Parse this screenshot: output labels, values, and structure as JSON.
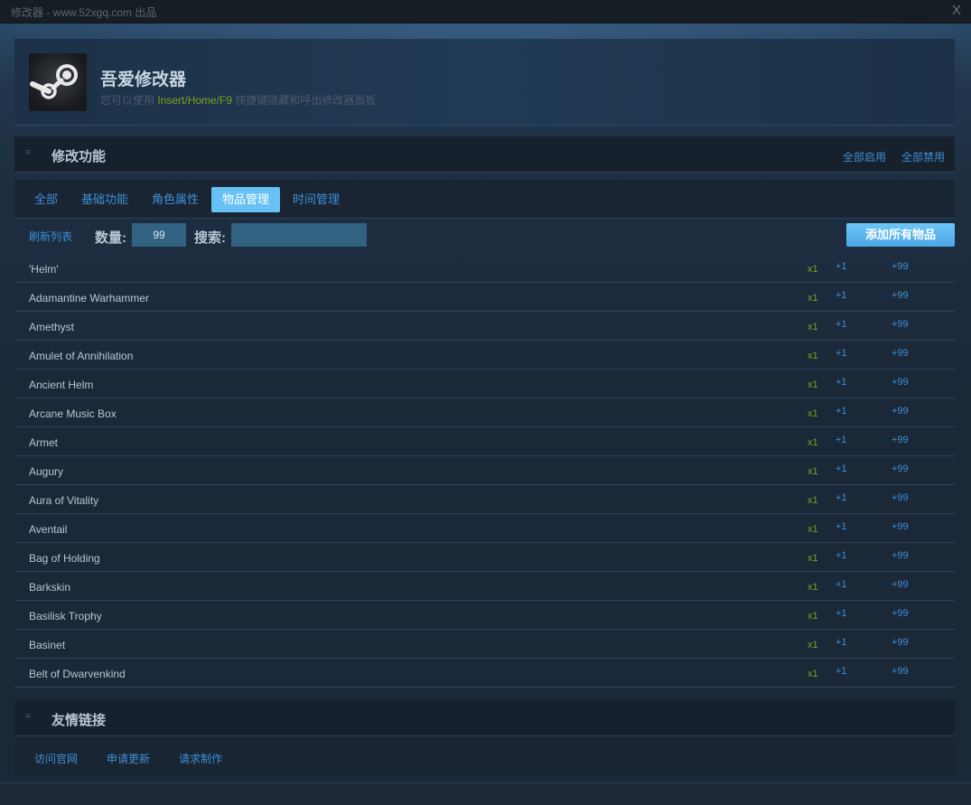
{
  "window": {
    "title": "修改器 - www.52xgq.com 出品",
    "close_label": "X"
  },
  "header": {
    "app_title": "吾爱修改器",
    "subtitle_prefix": "您可以使用",
    "hotkeys": "Insert/Home/F9",
    "subtitle_suffix": "快捷键隐藏和呼出修改器面板"
  },
  "features": {
    "grip": "=",
    "title": "修改功能",
    "enable_all": "全部启用",
    "disable_all": "全部禁用",
    "tabs": [
      {
        "label": "全部",
        "active": false
      },
      {
        "label": "基础功能",
        "active": false
      },
      {
        "label": "角色属性",
        "active": false
      },
      {
        "label": "物品管理",
        "active": true
      },
      {
        "label": "时间管理",
        "active": false
      }
    ]
  },
  "toolbar": {
    "refresh_label": "刷新列表",
    "quantity_label": "数量:",
    "quantity_value": "99",
    "search_label": "搜索:",
    "search_value": "",
    "add_all_label": "添加所有物品"
  },
  "items": [
    {
      "name": "'Helm'",
      "count": "x1",
      "plus1": "+1",
      "plus99": "+99"
    },
    {
      "name": "Adamantine Warhammer",
      "count": "x1",
      "plus1": "+1",
      "plus99": "+99"
    },
    {
      "name": "Amethyst",
      "count": "x1",
      "plus1": "+1",
      "plus99": "+99"
    },
    {
      "name": "Amulet of Annihilation",
      "count": "x1",
      "plus1": "+1",
      "plus99": "+99"
    },
    {
      "name": "Ancient Helm",
      "count": "x1",
      "plus1": "+1",
      "plus99": "+99"
    },
    {
      "name": "Arcane Music Box",
      "count": "x1",
      "plus1": "+1",
      "plus99": "+99"
    },
    {
      "name": "Armet",
      "count": "x1",
      "plus1": "+1",
      "plus99": "+99"
    },
    {
      "name": "Augury",
      "count": "x1",
      "plus1": "+1",
      "plus99": "+99"
    },
    {
      "name": "Aura of Vitality",
      "count": "x1",
      "plus1": "+1",
      "plus99": "+99"
    },
    {
      "name": "Aventail",
      "count": "x1",
      "plus1": "+1",
      "plus99": "+99"
    },
    {
      "name": "Bag of Holding",
      "count": "x1",
      "plus1": "+1",
      "plus99": "+99"
    },
    {
      "name": "Barkskin",
      "count": "x1",
      "plus1": "+1",
      "plus99": "+99"
    },
    {
      "name": "Basilisk Trophy",
      "count": "x1",
      "plus1": "+1",
      "plus99": "+99"
    },
    {
      "name": "Basinet",
      "count": "x1",
      "plus1": "+1",
      "plus99": "+99"
    },
    {
      "name": "Belt of Dwarvenkind",
      "count": "x1",
      "plus1": "+1",
      "plus99": "+99"
    }
  ],
  "links": {
    "grip": "=",
    "title": "友情链接",
    "items": [
      "访问官网",
      "申请更新",
      "请求制作"
    ]
  },
  "colors": {
    "accent_blue": "#3d8fd6",
    "active_tab": "#67c1f5",
    "count_green": "#7aa51b",
    "input_bg": "#316282"
  },
  "icons": {
    "logo": "steam-logo-icon"
  }
}
